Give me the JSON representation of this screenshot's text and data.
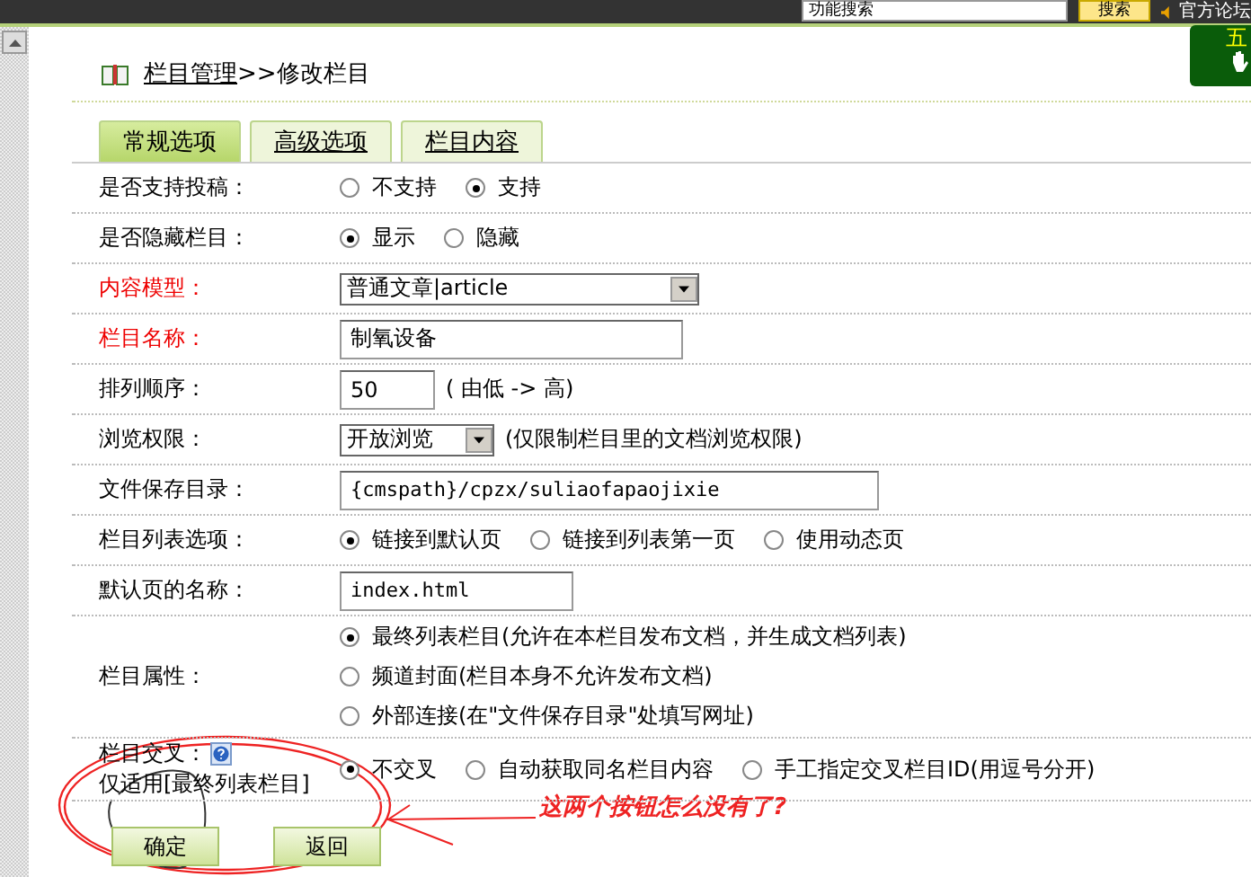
{
  "top_bar": {
    "search_placeholder": "功能搜索",
    "search_button": "搜索",
    "forum_link": "官方论坛",
    "widget_text": "五"
  },
  "breadcrumb": {
    "link": "栏目管理",
    "current": ">>修改栏目"
  },
  "tabs": [
    {
      "label": "常规选项",
      "selected": true
    },
    {
      "label": "高级选项",
      "selected": false
    },
    {
      "label": "栏目内容",
      "selected": false
    }
  ],
  "rows": [
    {
      "kind": "radios",
      "label": "是否支持投稿：",
      "required": false,
      "options": [
        {
          "label": "不支持",
          "selected": false
        },
        {
          "label": "支持",
          "selected": true
        }
      ]
    },
    {
      "kind": "radios",
      "label": "是否隐藏栏目：",
      "required": false,
      "options": [
        {
          "label": "显示",
          "selected": true
        },
        {
          "label": "隐藏",
          "selected": false
        }
      ]
    },
    {
      "kind": "select",
      "label": "内容模型：",
      "required": true,
      "value": "普通文章|article"
    },
    {
      "kind": "input",
      "label": "栏目名称：",
      "required": true,
      "value": "制氧设备"
    },
    {
      "kind": "input",
      "label": "排列顺序：",
      "required": false,
      "value": "50",
      "note": "( 由低 -> 高)"
    },
    {
      "kind": "select",
      "label": "浏览权限：",
      "required": false,
      "value": "开放浏览",
      "note": "(仅限制栏目里的文档浏览权限)"
    },
    {
      "kind": "input",
      "label": "文件保存目录：",
      "required": false,
      "value": "{cmspath}/cpzx/suliaofapaojixie"
    },
    {
      "kind": "radios",
      "label": "栏目列表选项：",
      "required": false,
      "options": [
        {
          "label": "链接到默认页",
          "selected": true
        },
        {
          "label": "链接到列表第一页",
          "selected": false
        },
        {
          "label": "使用动态页",
          "selected": false
        }
      ]
    },
    {
      "kind": "input",
      "label": "默认页的名称：",
      "required": false,
      "value": "index.html"
    },
    {
      "kind": "stacked",
      "label": "栏目属性：",
      "required": false,
      "options": [
        {
          "label": "最终列表栏目(允许在本栏目发布文档，并生成文档列表)",
          "selected": true
        },
        {
          "label": "频道封面(栏目本身不允许发布文档)",
          "selected": false
        },
        {
          "label": "外部连接(在\"文件保存目录\"处填写网址)",
          "selected": false
        }
      ]
    },
    {
      "kind": "radios",
      "label": "栏目交叉：",
      "sublabel": "仅适用[最终列表栏目]",
      "help": true,
      "required": false,
      "options": [
        {
          "label": "不交叉",
          "selected": true
        },
        {
          "label": "自动获取同名栏目内容",
          "selected": false
        },
        {
          "label": "手工指定交叉栏目ID(用逗号分开)",
          "selected": false
        }
      ]
    }
  ],
  "buttons": [
    "确定",
    "返回"
  ],
  "annotation": "这两个按钮怎么没有了?"
}
